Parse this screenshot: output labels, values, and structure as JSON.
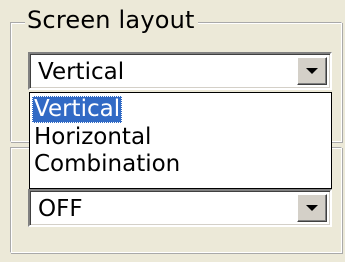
{
  "screen_layout_group": {
    "legend": "Screen layout",
    "combo": {
      "value": "Vertical",
      "button_icon": "chevron-down-icon"
    },
    "dropdown": {
      "options": [
        "Vertical",
        "Horizontal",
        "Combination"
      ],
      "selected_index": 0
    }
  },
  "second_group": {
    "combo": {
      "value": "OFF",
      "button_icon": "chevron-down-icon"
    }
  },
  "colors": {
    "panel_background": "#ece9d8",
    "selection_background": "#316ac5",
    "selection_text": "#ffffff"
  }
}
